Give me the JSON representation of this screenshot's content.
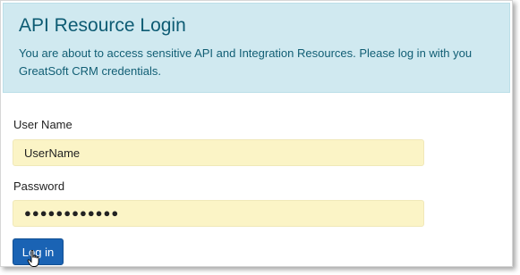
{
  "banner": {
    "title": "API Resource Login",
    "message": "You are about to access sensitive API and Integration Resources. Please log in with you GreatSoft CRM credentials."
  },
  "form": {
    "username_label": "User Name",
    "username_value": "UserName",
    "password_label": "Password",
    "password_value": "●●●●●●●●●●●●",
    "submit_label": "Log in"
  },
  "colors": {
    "banner_bg": "#d0e9f0",
    "banner_text": "#0d5b73",
    "field_bg": "#fbf4c6",
    "button_bg": "#1a63b4"
  },
  "icons": {
    "cursor": "hand-pointer-icon"
  }
}
